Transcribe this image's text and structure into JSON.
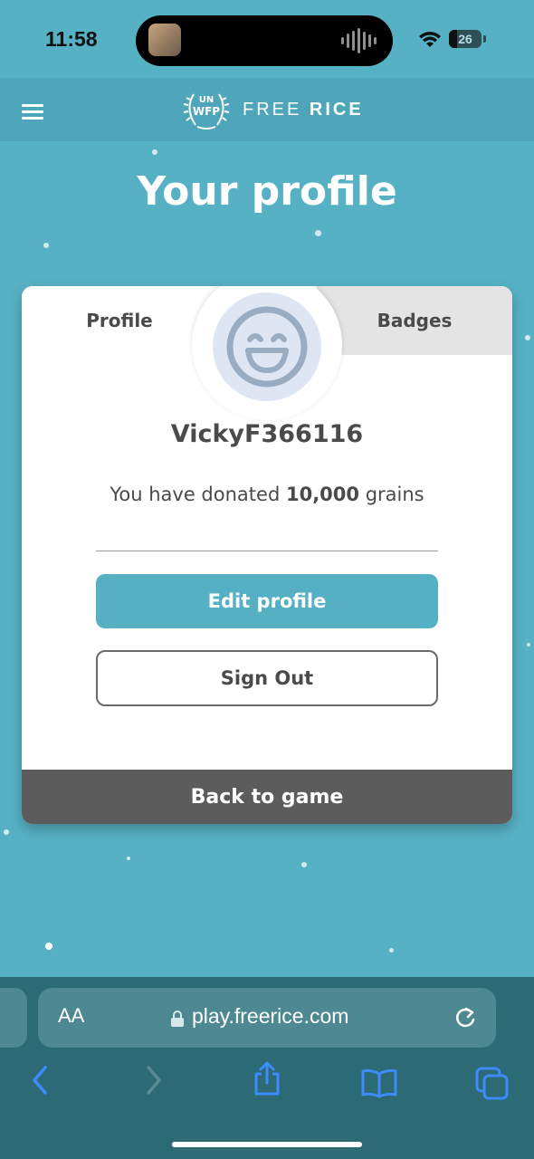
{
  "status_bar": {
    "time": "11:58",
    "battery": "26",
    "battery_percent": 26
  },
  "header": {
    "logo_un": "UN",
    "logo_wfp": "WFP",
    "logo_free": "FREE",
    "logo_rice": "RICE",
    "menu_icon": "hamburger-menu-icon"
  },
  "page": {
    "title": "Your profile"
  },
  "card": {
    "tabs": [
      {
        "label": "Profile",
        "active": true
      },
      {
        "label": "Badges",
        "active": false
      }
    ],
    "avatar_icon": "smiley-face-icon",
    "username": "VickyF366116",
    "donated_prefix": "You have donated",
    "donated_amount": "10,000",
    "donated_suffix": "grains",
    "edit_button": "Edit profile",
    "signout_button": "Sign Out",
    "back_button": "Back to game"
  },
  "browser": {
    "text_size_label": "AA",
    "url": "play.freerice.com",
    "icons": [
      "back-arrow-icon",
      "forward-arrow-icon",
      "share-icon",
      "bookmarks-icon",
      "tabs-icon"
    ]
  },
  "colors": {
    "background": "#57b1c5",
    "header": "#4fa6ba",
    "accent": "#56b0c4",
    "back_button": "#5c5c5c",
    "browser_bar": "#2c6a75",
    "safari_blue": "#3d8bfd"
  }
}
